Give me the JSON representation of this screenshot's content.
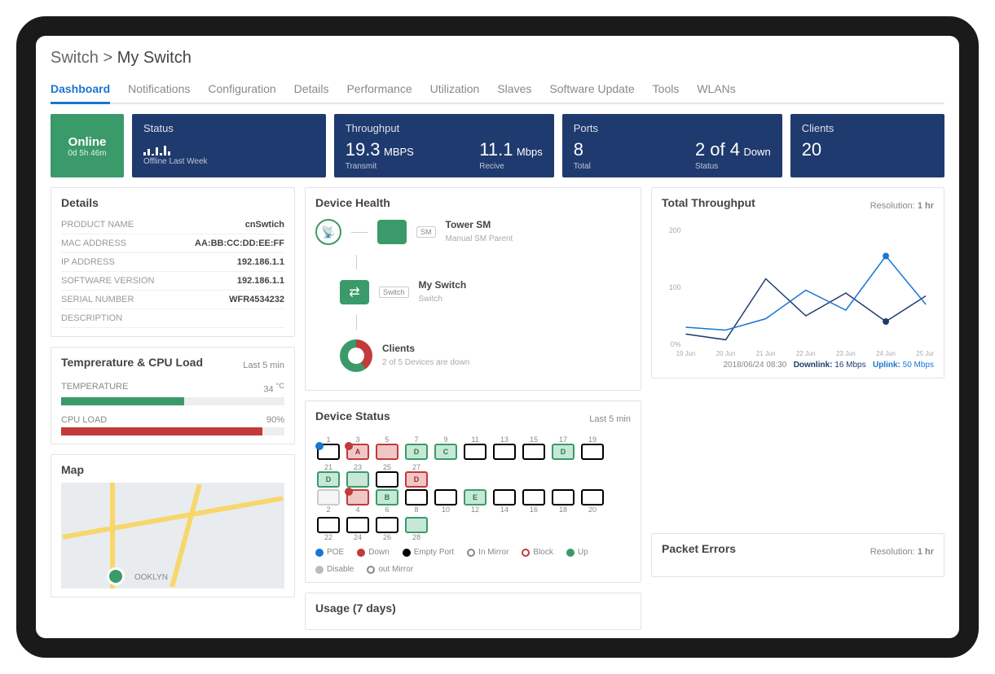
{
  "breadcrumb": {
    "parent": "Switch",
    "sep": ">",
    "current": "My Switch"
  },
  "tabs": [
    "Dashboard",
    "Notifications",
    "Configuration",
    "Details",
    "Performance",
    "Utilization",
    "Slaves",
    "Software Update",
    "Tools",
    "WLANs"
  ],
  "activeTab": 0,
  "stats": {
    "online": {
      "label": "Online",
      "uptime": "0d 5h 46m"
    },
    "status": {
      "title": "Status",
      "offline_note": "Offline Last Week",
      "spark": [
        4,
        8,
        2,
        10,
        3,
        12,
        5
      ]
    },
    "throughput": {
      "title": "Throughput",
      "tx_val": "19.3",
      "tx_unit": "MBPS",
      "tx_label": "Transmit",
      "rx_val": "11.1",
      "rx_unit": "Mbps",
      "rx_label": "Recive"
    },
    "ports": {
      "title": "Ports",
      "total_val": "8",
      "total_label": "Total",
      "status_val": "2 of 4",
      "status_suffix": "Down",
      "status_label": "Status"
    },
    "clients": {
      "title": "Clients",
      "value": "20"
    }
  },
  "details": {
    "title": "Details",
    "rows": [
      {
        "k": "PRODUCT NAME",
        "v": "cnSwtich"
      },
      {
        "k": "MAC ADDRESS",
        "v": "AA:BB:CC:DD:EE:FF"
      },
      {
        "k": "IP ADDRESS",
        "v": "192.186.1.1"
      },
      {
        "k": "SOFTWARE VERSION",
        "v": "192.186.1.1"
      },
      {
        "k": "SERIAL NUMBER",
        "v": "WFR4534232"
      },
      {
        "k": "DESCRIPTION",
        "v": ""
      }
    ]
  },
  "tempcpu": {
    "title": "Temprerature & CPU Load",
    "range": "Last 5 min",
    "temp_label": "TEMPERATURE",
    "temp_val": "34",
    "temp_unit": "°C",
    "temp_pct": 55,
    "cpu_label": "CPU LOAD",
    "cpu_val": "90%",
    "cpu_pct": 90
  },
  "map": {
    "title": "Map"
  },
  "device_health": {
    "title": "Device Health",
    "nodes": [
      {
        "label": "Tower SM",
        "sub": "Manual SM Parent",
        "tag": "SM"
      },
      {
        "label": "My Switch",
        "sub": "Switch",
        "tag": "Switch"
      },
      {
        "label": "Clients",
        "sub": "2 of 5 Devices are down"
      }
    ]
  },
  "device_status": {
    "title": "Device Status",
    "range": "Last 5 min",
    "top_nums": [
      "1",
      "3",
      "5",
      "7",
      "9",
      "11",
      "13",
      "15",
      "17",
      "19",
      "21",
      "23",
      "25",
      "27"
    ],
    "top_state": [
      "empty-poe",
      "red-block",
      "red",
      "green",
      "green",
      "empty",
      "empty",
      "empty",
      "green",
      "empty",
      "green",
      "green",
      "empty",
      "red"
    ],
    "top_letter": [
      "",
      "A",
      "",
      "D",
      "C",
      "",
      "",
      "",
      "D",
      "",
      "D",
      "",
      "",
      "D"
    ],
    "bot_nums": [
      "2",
      "4",
      "6",
      "8",
      "10",
      "12",
      "14",
      "16",
      "18",
      "20",
      "22",
      "24",
      "26",
      "28"
    ],
    "bot_state": [
      "disabled",
      "red-block",
      "green",
      "empty",
      "empty",
      "green",
      "empty",
      "empty",
      "empty",
      "empty",
      "empty",
      "empty",
      "empty",
      "green"
    ],
    "bot_letter": [
      "",
      "",
      "B",
      "",
      "",
      "E",
      "",
      "",
      "",
      "",
      "",
      "",
      "",
      ""
    ],
    "legend": [
      {
        "color": "#1976d2",
        "label": "POE",
        "shape": "dot"
      },
      {
        "color": "#c23a3a",
        "label": "Down",
        "shape": "dot"
      },
      {
        "color": "#000",
        "label": "Empty Port",
        "shape": "dot"
      },
      {
        "color": "#888",
        "label": "In Mirror",
        "shape": "ring"
      },
      {
        "color": "#c23a3a",
        "label": "Block",
        "shape": "ring"
      },
      {
        "color": "#3a9a6a",
        "label": "Up",
        "shape": "dot"
      },
      {
        "color": "#bbb",
        "label": "Disable",
        "shape": "dot"
      },
      {
        "color": "#888",
        "label": "out Mirror",
        "shape": "ring"
      }
    ]
  },
  "total_throughput": {
    "title": "Total Throughput",
    "resolution_label": "Resolution:",
    "resolution_val": "1 hr",
    "timestamp": "2018/06/24 08:30",
    "dl_label": "Downlink:",
    "dl_val": "16 Mbps",
    "ul_label": "Uplink:",
    "ul_val": "50 Mbps"
  },
  "chart_data": {
    "type": "line",
    "title": "Total Throughput",
    "xlabel": "",
    "ylabel": "",
    "ylim": [
      0,
      200
    ],
    "yticks": [
      0,
      100,
      200
    ],
    "categories": [
      "19 Jun",
      "20 Jun",
      "21 Jun",
      "22 Jun",
      "23 Jun",
      "24 Jun",
      "25 Jun"
    ],
    "series": [
      {
        "name": "Downlink",
        "color": "#1f3a6e",
        "values": [
          18,
          8,
          115,
          50,
          90,
          40,
          85
        ]
      },
      {
        "name": "Uplink",
        "color": "#1976d2",
        "values": [
          30,
          25,
          45,
          95,
          60,
          155,
          70
        ]
      }
    ],
    "markers": [
      {
        "series": "Uplink",
        "x": "24 Jun",
        "y": 155
      },
      {
        "series": "Downlink",
        "x": "24 Jun",
        "y": 40
      }
    ]
  },
  "usage": {
    "title": "Usage (7 days)"
  },
  "packet_errors": {
    "title": "Packet Errors",
    "resolution_label": "Resolution:",
    "resolution_val": "1 hr"
  }
}
